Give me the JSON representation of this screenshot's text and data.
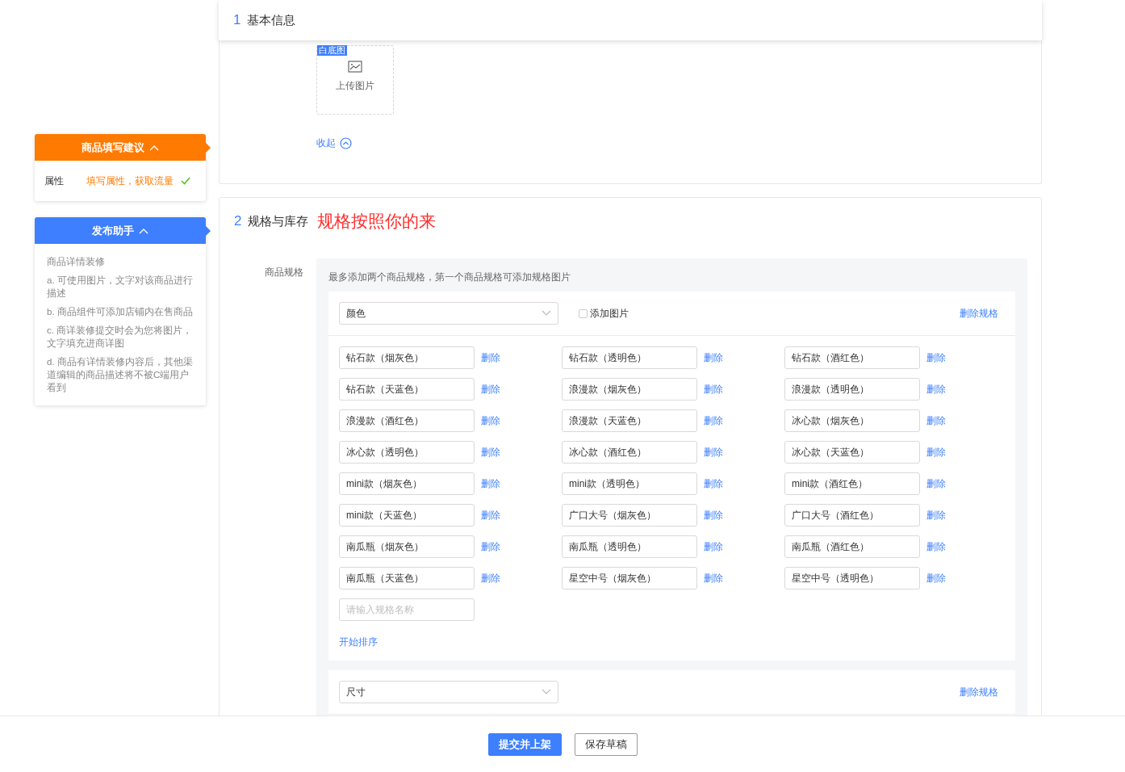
{
  "header": {
    "step": "1",
    "title": "基本信息"
  },
  "section1": {
    "image_label": "白底图",
    "upload_text": "上传图片",
    "collapse_link": "收起"
  },
  "sidebar": [
    {
      "kind": "suggestion",
      "title": "商品填写建议",
      "expanded": true,
      "rows": [
        {
          "label": "属性",
          "text": "填写属性，获取流量",
          "done": true
        }
      ]
    },
    {
      "kind": "helper",
      "title": "发布助手",
      "expanded": true,
      "lines": [
        "商品详情装修",
        "a. 可使用图片，文字对该商品进行描述",
        "b. 商品组件可添加店铺内在售商品",
        "c. 商详装修提交时会为您将图片，文字填充进商详图",
        "d. 商品有详情装修内容后，其他渠道编辑的商品描述将不被C端用户看到"
      ]
    }
  ],
  "section2": {
    "step": "2",
    "title": "规格与库存",
    "note": "规格按照你的来",
    "field_label": "商品规格",
    "hint": "最多添加两个商品规格，第一个商品规格可添加规格图片",
    "specs": [
      {
        "name": "颜色",
        "add_image": {
          "label": "添加图片",
          "checked": false
        },
        "delete_label": "删除规格",
        "values": [
          {
            "value": "钻石款（烟灰色）",
            "delete": "删除"
          },
          {
            "value": "钻石款（透明色）",
            "delete": "删除"
          },
          {
            "value": "钻石款（酒红色）",
            "delete": "删除"
          },
          {
            "value": "钻石款（天蓝色）",
            "delete": "删除"
          },
          {
            "value": "浪漫款（烟灰色）",
            "delete": "删除"
          },
          {
            "value": "浪漫款（透明色）",
            "delete": "删除"
          },
          {
            "value": "浪漫款（酒红色）",
            "delete": "删除"
          },
          {
            "value": "浪漫款（天蓝色）",
            "delete": "删除"
          },
          {
            "value": "冰心款（烟灰色）",
            "delete": "删除"
          },
          {
            "value": "冰心款（透明色）",
            "delete": "删除"
          },
          {
            "value": "冰心款（酒红色）",
            "delete": "删除"
          },
          {
            "value": "冰心款（天蓝色）",
            "delete": "删除"
          },
          {
            "value": "mini款（烟灰色）",
            "delete": "删除"
          },
          {
            "value": "mini款（透明色）",
            "delete": "删除"
          },
          {
            "value": "mini款（酒红色）",
            "delete": "删除"
          },
          {
            "value": "mini款（天蓝色）",
            "delete": "删除"
          },
          {
            "value": "广口大号（烟灰色）",
            "delete": "删除"
          },
          {
            "value": "广口大号（酒红色）",
            "delete": "删除"
          },
          {
            "value": "南瓜瓶（烟灰色）",
            "delete": "删除"
          },
          {
            "value": "南瓜瓶（透明色）",
            "delete": "删除"
          },
          {
            "value": "南瓜瓶（酒红色）",
            "delete": "删除"
          },
          {
            "value": "南瓜瓶（天蓝色）",
            "delete": "删除"
          },
          {
            "value": "星空中号（烟灰色）",
            "delete": "删除"
          },
          {
            "value": "星空中号（透明色）",
            "delete": "删除"
          }
        ],
        "new_placeholder": "请输入规格名称",
        "sort_link": "开始排序"
      },
      {
        "name": "尺寸",
        "delete_label": "删除规格"
      }
    ]
  },
  "footer": {
    "buttons": [
      {
        "kind": "primary",
        "label": "提交并上架"
      },
      {
        "kind": "default",
        "label": "保存草稿"
      }
    ]
  }
}
